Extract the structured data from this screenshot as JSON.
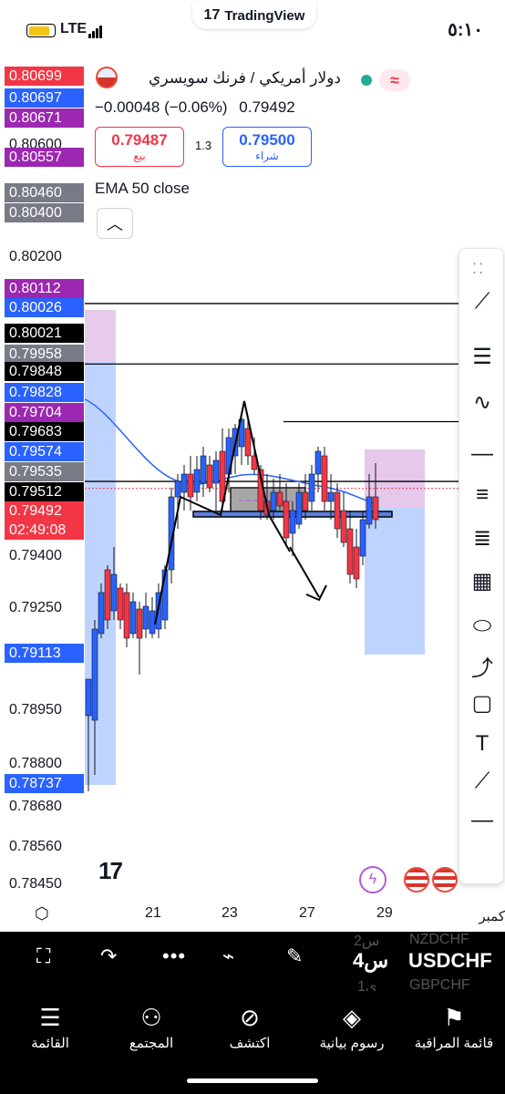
{
  "status": {
    "time": "٥:١٠",
    "network": "LTE",
    "app_pill": "TradingView"
  },
  "header": {
    "symbol_title": "دولار أمريكي / فرنك سويسري",
    "change": "−0.00048 (−0.06%)",
    "last": "0.79492",
    "sell_price": "0.79487",
    "sell_label": "بيع",
    "spread": "1.3",
    "buy_price": "0.79500",
    "buy_label": "شراء",
    "indicator": "EMA 50 close",
    "collapse_icon": "chevron-up-icon"
  },
  "price_labels": [
    {
      "text": "0.80699",
      "bg": "#f23645"
    },
    {
      "text": "0.80697",
      "bg": "#2962ff"
    },
    {
      "text": "0.80671",
      "bg": "#9c27b0"
    },
    {
      "text": "0.80600",
      "bg": ""
    },
    {
      "text": "0.80557",
      "bg": "#9c27b0"
    },
    {
      "text": "0.80460",
      "bg": "#787b86"
    },
    {
      "text": "0.80400",
      "bg": "#787b86"
    },
    {
      "text": "0.80200",
      "bg": ""
    },
    {
      "text": "0.80112",
      "bg": "#9c27b0"
    },
    {
      "text": "0.80026",
      "bg": "#2962ff"
    },
    {
      "text": "0.80021",
      "bg": "#000000"
    },
    {
      "text": "0.79958",
      "bg": "#787b86"
    },
    {
      "text": "0.79848",
      "bg": "#000000"
    },
    {
      "text": "0.79828",
      "bg": "#2962ff"
    },
    {
      "text": "0.79704",
      "bg": "#9c27b0"
    },
    {
      "text": "0.79683",
      "bg": "#000000"
    },
    {
      "text": "0.79574",
      "bg": "#2962ff"
    },
    {
      "text": "0.79535",
      "bg": "#787b86"
    },
    {
      "text": "0.79512",
      "bg": "#000000"
    },
    {
      "text": "0.79492",
      "bg": "#f23645"
    },
    {
      "text": "02:49:08",
      "bg": "#f23645"
    },
    {
      "text": "0.79400",
      "bg": ""
    },
    {
      "text": "0.79250",
      "bg": ""
    },
    {
      "text": "0.79113",
      "bg": "#2962ff"
    },
    {
      "text": "0.78950",
      "bg": ""
    },
    {
      "text": "0.78800",
      "bg": ""
    },
    {
      "text": "0.78737",
      "bg": "#2962ff"
    },
    {
      "text": "0.78680",
      "bg": ""
    },
    {
      "text": "0.78560",
      "bg": ""
    },
    {
      "text": "0.78450",
      "bg": ""
    }
  ],
  "x_axis": {
    "labels": [
      "21",
      "23",
      "27",
      "29"
    ],
    "month_fragment": "كمبر"
  },
  "chart_data": {
    "type": "candlestick",
    "ema_label": "EMA 50 close",
    "last_price": 0.79492,
    "horizontal_levels": [
      0.80021,
      0.79848,
      0.79683,
      0.79512
    ]
  },
  "toolbar": {
    "tools": [
      "trend-lines-icon",
      "fib-retracement-icon",
      "patterns-icon",
      "horizontal-line-icon",
      "fib-lines-icon",
      "parallel-lines-icon",
      "gann-icon",
      "ellipse-icon",
      "path-icon",
      "rectangle-icon",
      "text-icon",
      "trend-line-icon",
      "ray-icon"
    ]
  },
  "bottom_bar": {
    "symbol": "USDCHF",
    "interval": "4س",
    "bg_symbol_top": "NZDCHF",
    "bg_interval_top": "2س",
    "bg_symbol_bottom": "GBPCHF",
    "bg_interval_bottom": "1ي"
  },
  "tabs": [
    {
      "label": "قائمة المراقبة",
      "icon": "watchlist-icon"
    },
    {
      "label": "رسوم بيانية",
      "icon": "charts-icon"
    },
    {
      "label": "اكتشف",
      "icon": "explore-icon"
    },
    {
      "label": "المجتمع",
      "icon": "community-icon"
    },
    {
      "label": "القائمة",
      "icon": "menu-icon"
    }
  ]
}
